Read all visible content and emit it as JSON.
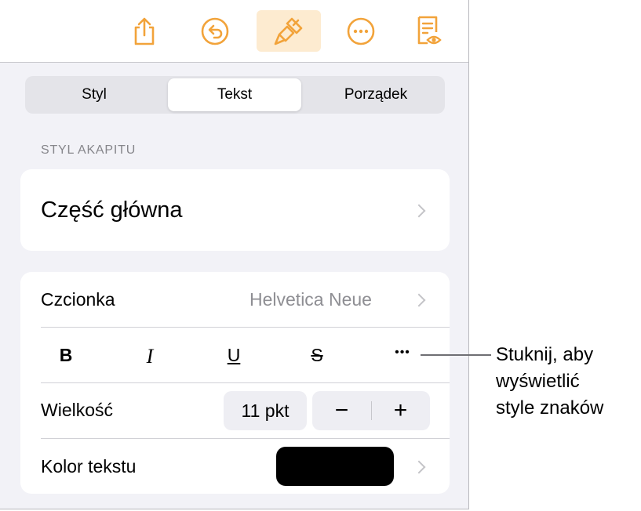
{
  "toolbar": {
    "buttons": [
      {
        "icon": "share-icon"
      },
      {
        "icon": "undo-icon"
      },
      {
        "icon": "format-brush-icon",
        "active": true
      },
      {
        "icon": "more-icon"
      },
      {
        "icon": "reader-view-icon"
      }
    ],
    "accent_color": "#f2a33a",
    "active_bg": "#fdebd0"
  },
  "tabs": [
    {
      "label": "Styl",
      "selected": false
    },
    {
      "label": "Tekst",
      "selected": true
    },
    {
      "label": "Porządek",
      "selected": false
    }
  ],
  "paragraph_style": {
    "header": "STYL AKAPITU",
    "value": "Część główna"
  },
  "font_card": {
    "font_label": "Czcionka",
    "font_value": "Helvetica Neue",
    "format_buttons": {
      "bold": "B",
      "italic": "I",
      "underline": "U",
      "strike": "S",
      "more": "•••"
    },
    "size_label": "Wielkość",
    "size_value": "11 pkt",
    "decrease": "−",
    "increase": "+",
    "color_label": "Kolor tekstu",
    "text_color": "#000000"
  },
  "callout": {
    "lines": [
      "Stuknij, aby",
      "wyświetlić",
      "style znaków"
    ]
  }
}
